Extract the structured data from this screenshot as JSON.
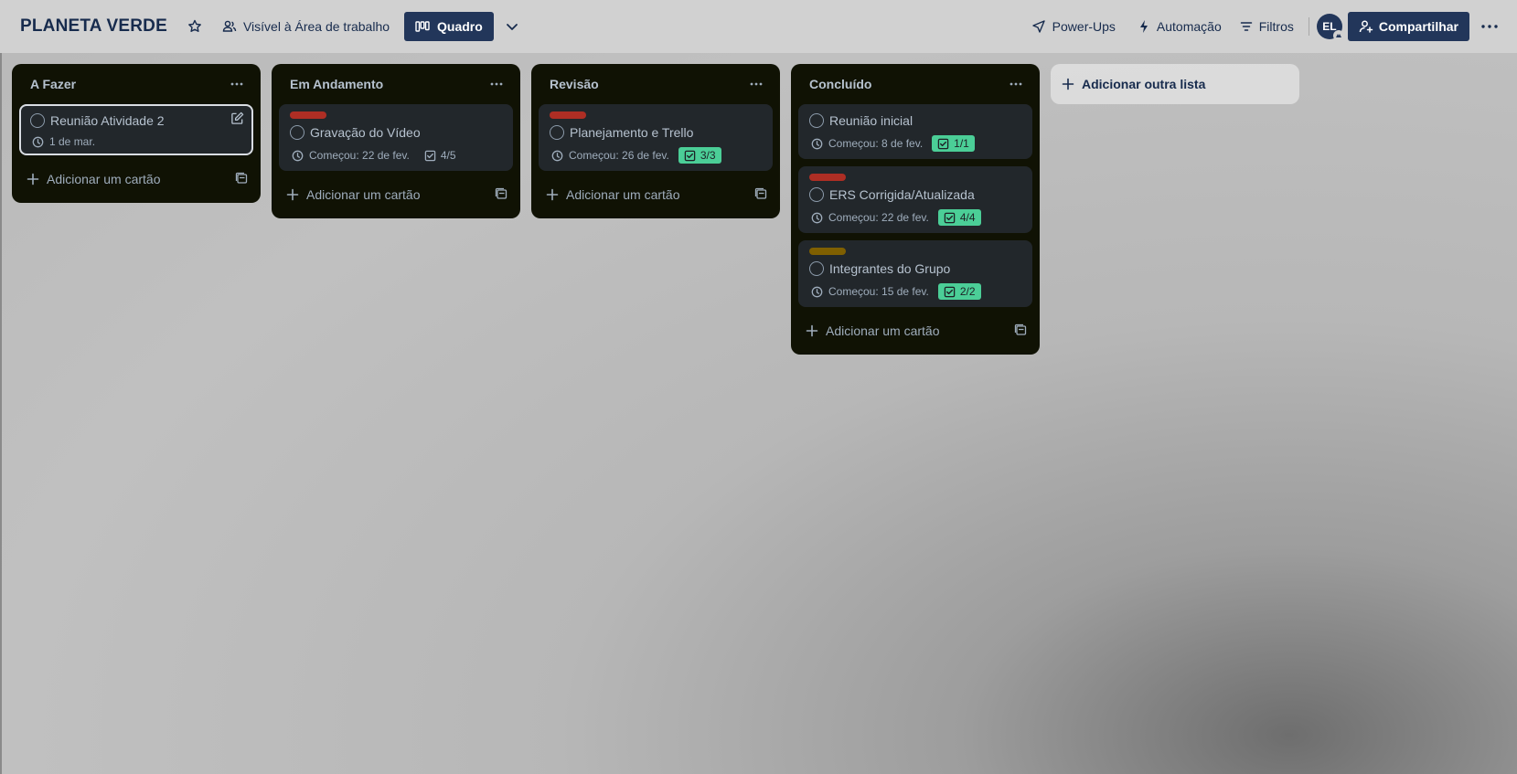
{
  "header": {
    "board_title": "PLANETA VERDE",
    "visibility_label": "Visível à Área de trabalho",
    "view_label": "Quadro",
    "powerups_label": "Power-Ups",
    "automation_label": "Automação",
    "filters_label": "Filtros",
    "avatar_initials": "EL",
    "share_label": "Compartilhar"
  },
  "lists": [
    {
      "title": "A Fazer",
      "add_card_label": "Adicionar um cartão",
      "cards": [
        {
          "title": "Reunião Atividade 2",
          "date": "1 de mar."
        }
      ]
    },
    {
      "title": "Em Andamento",
      "add_card_label": "Adicionar um cartão",
      "cards": [
        {
          "title": "Gravação do Vídeo",
          "date": "Começou: 22 de fev.",
          "checklist": "4/5",
          "label_color": "#ae2e24"
        }
      ]
    },
    {
      "title": "Revisão",
      "add_card_label": "Adicionar um cartão",
      "cards": [
        {
          "title": "Planejamento e Trello",
          "date": "Começou: 26 de fev.",
          "checklist": "3/3",
          "label_color": "#ae2e24"
        }
      ]
    },
    {
      "title": "Concluído",
      "add_card_label": "Adicionar um cartão",
      "cards": [
        {
          "title": "Reunião inicial",
          "date": "Começou: 8 de fev.",
          "checklist": "1/1"
        },
        {
          "title": "ERS Corrigida/Atualizada",
          "date": "Começou: 22 de fev.",
          "checklist": "4/4",
          "label_color": "#ae2e24"
        },
        {
          "title": "Integrantes do Grupo",
          "date": "Começou: 15 de fev.",
          "checklist": "2/2",
          "label_color": "#7f5f01"
        }
      ]
    }
  ],
  "add_list_label": "Adicionar outra lista",
  "colors": {
    "header_bg": "#d1d1d1",
    "accent": "#22365a",
    "list_bg": "#101204",
    "card_bg": "#22272b",
    "checklist_done": "#4bce97"
  },
  "icons": [
    "star-icon",
    "people-icon",
    "board-icon",
    "chevron-down-icon",
    "rocket-icon",
    "bolt-icon",
    "filter-icon",
    "add-person-icon",
    "more-icon",
    "clock-icon",
    "checklist-icon",
    "plus-icon",
    "template-icon",
    "edit-icon"
  ]
}
